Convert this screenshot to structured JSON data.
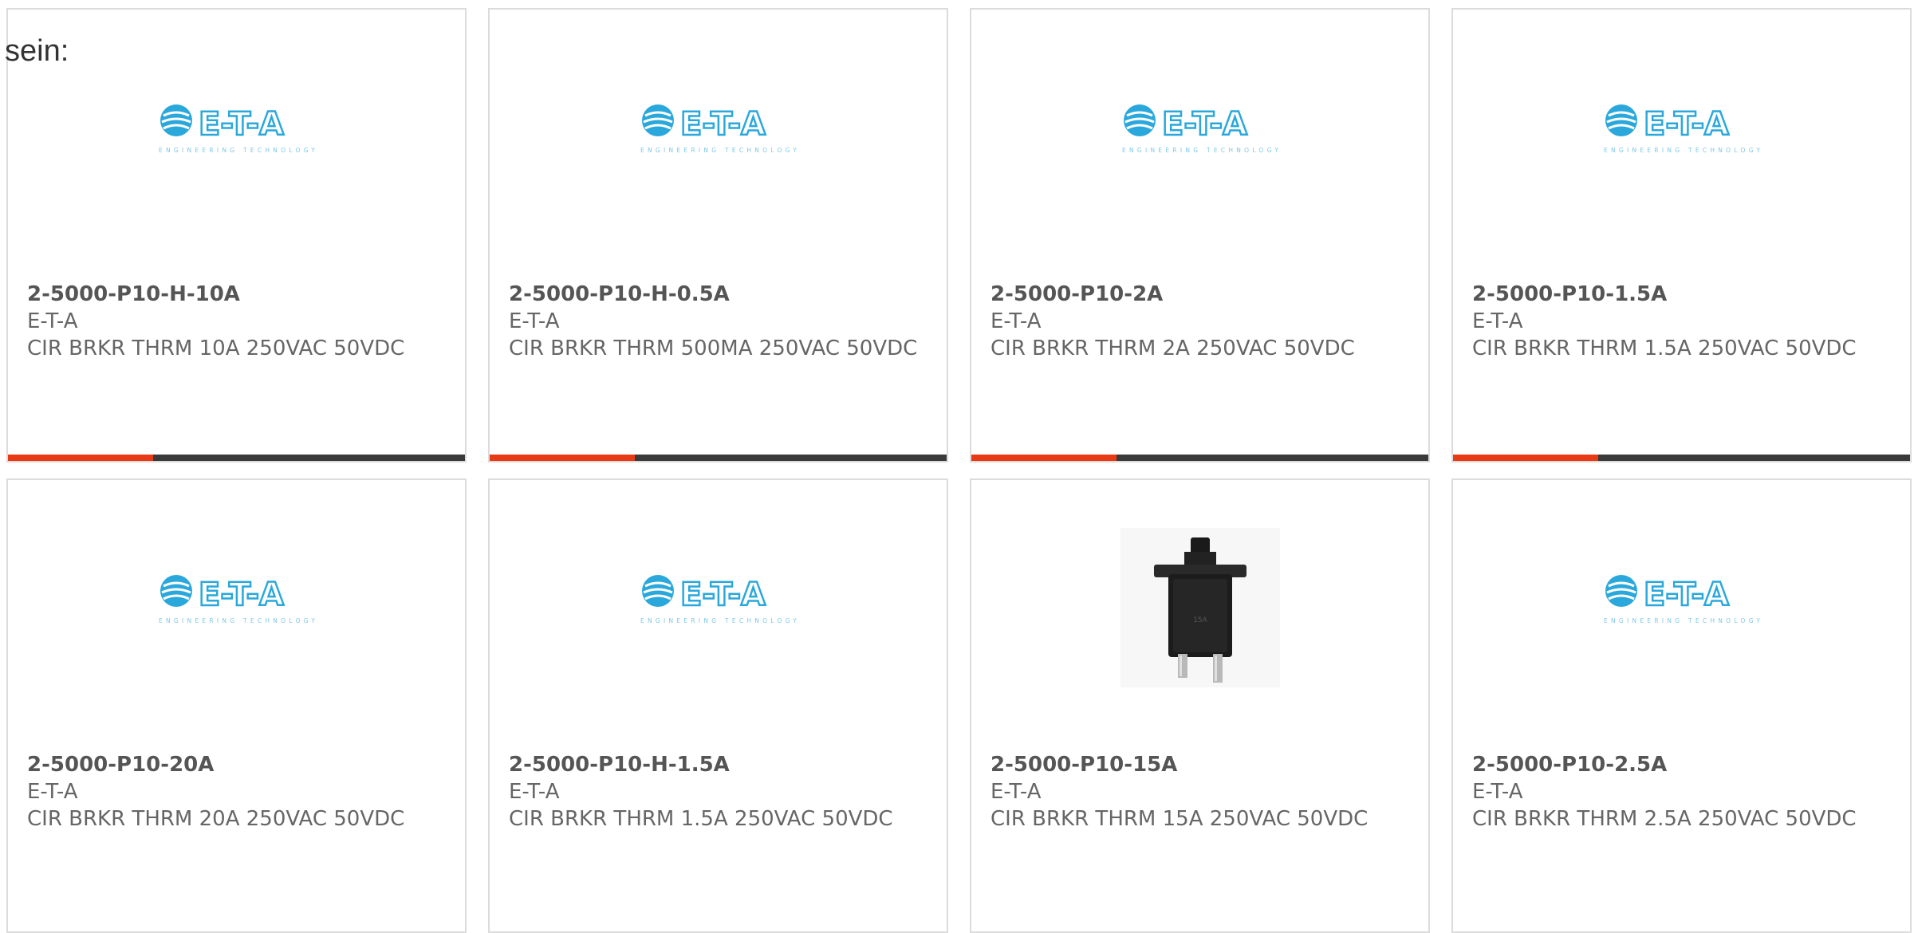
{
  "intro_text": "sein:",
  "colors": {
    "accent": "#e83a14",
    "bar_dark": "#3a3a3a",
    "logo_blue": "#2aa8dc",
    "text_gray": "#666666",
    "border": "#dcdcdc"
  },
  "products": [
    {
      "part_number": "2-5000-P10-H-10A",
      "manufacturer": "E-T-A",
      "description": "CIR BRKR THRM 10A 250VAC 50VDC",
      "image": "eta-logo",
      "logo": {
        "brand": "E-T-A",
        "tagline": "ENGINEERING TECHNOLOGY"
      }
    },
    {
      "part_number": "2-5000-P10-H-0.5A",
      "manufacturer": "E-T-A",
      "description": "CIR BRKR THRM 500MA 250VAC 50VDC",
      "image": "eta-logo",
      "logo": {
        "brand": "E-T-A",
        "tagline": "ENGINEERING TECHNOLOGY"
      }
    },
    {
      "part_number": "2-5000-P10-2A",
      "manufacturer": "E-T-A",
      "description": "CIR BRKR THRM 2A 250VAC 50VDC",
      "image": "eta-logo",
      "logo": {
        "brand": "E-T-A",
        "tagline": "ENGINEERING TECHNOLOGY"
      }
    },
    {
      "part_number": "2-5000-P10-1.5A",
      "manufacturer": "E-T-A",
      "description": "CIR BRKR THRM 1.5A 250VAC 50VDC",
      "image": "eta-logo",
      "logo": {
        "brand": "E-T-A",
        "tagline": "ENGINEERING TECHNOLOGY"
      }
    },
    {
      "part_number": "2-5000-P10-20A",
      "manufacturer": "E-T-A",
      "description": "CIR BRKR THRM 20A 250VAC 50VDC",
      "image": "eta-logo",
      "logo": {
        "brand": "E-T-A",
        "tagline": "ENGINEERING TECHNOLOGY"
      }
    },
    {
      "part_number": "2-5000-P10-H-1.5A",
      "manufacturer": "E-T-A",
      "description": "CIR BRKR THRM 1.5A 250VAC 50VDC",
      "image": "eta-logo",
      "logo": {
        "brand": "E-T-A",
        "tagline": "ENGINEERING TECHNOLOGY"
      }
    },
    {
      "part_number": "2-5000-P10-15A",
      "manufacturer": "E-T-A",
      "description": "CIR BRKR THRM 15A 250VAC 50VDC",
      "image": "circuit-breaker-photo"
    },
    {
      "part_number": "2-5000-P10-2.5A",
      "manufacturer": "E-T-A",
      "description": "CIR BRKR THRM 2.5A 250VAC 50VDC",
      "image": "eta-logo",
      "logo": {
        "brand": "E-T-A",
        "tagline": "ENGINEERING TECHNOLOGY"
      }
    }
  ]
}
